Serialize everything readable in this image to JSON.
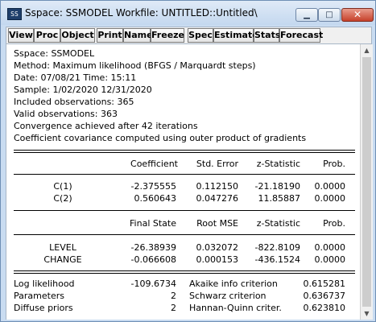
{
  "window": {
    "title": "Sspace: SSMODEL   Workfile: UNTITLED::Untitled\\",
    "icon_text": "SS",
    "controls": {
      "minimize": "▁",
      "maximize": "□",
      "close": "✕"
    }
  },
  "toolbar": [
    "View",
    "Proc",
    "Object",
    "Print",
    "Name",
    "Freeze",
    "Spec",
    "Estimate",
    "Stats",
    "Forecast"
  ],
  "header": [
    "Sspace: SSMODEL",
    "Method: Maximum likelihood  (BFGS / Marquardt steps)",
    "Date: 07/08/21   Time: 15:11",
    "Sample: 1/02/2020 12/31/2020",
    "Included observations: 365",
    "Valid observations: 363",
    "Convergence achieved after 42 iterations",
    "Coefficient covariance computed using outer product of gradients"
  ],
  "coef_table": {
    "headers": [
      "",
      "Coefficient",
      "Std. Error",
      "z-Statistic",
      "Prob."
    ],
    "rows": [
      [
        "C(1)",
        "-2.375555",
        "0.112150",
        "-21.18190",
        "0.0000"
      ],
      [
        "C(2)",
        "0.560643",
        "0.047276",
        "11.85887",
        "0.0000"
      ]
    ]
  },
  "state_table": {
    "headers": [
      "",
      "Final State",
      "Root MSE",
      "z-Statistic",
      "Prob."
    ],
    "rows": [
      [
        "LEVEL",
        "-26.38939",
        "0.032072",
        "-822.8109",
        "0.0000"
      ],
      [
        "CHANGE",
        "-0.066608",
        "0.000153",
        "-436.1524",
        "0.0000"
      ]
    ]
  },
  "stats": [
    [
      "Log likelihood",
      "-109.6734",
      "Akaike info criterion",
      "0.615281"
    ],
    [
      "Parameters",
      "2",
      "Schwarz criterion",
      "0.636737"
    ],
    [
      "Diffuse priors",
      "2",
      "Hannan-Quinn criter.",
      "0.623810"
    ]
  ],
  "scrollbar": {
    "up": "▲",
    "down": "▼"
  }
}
